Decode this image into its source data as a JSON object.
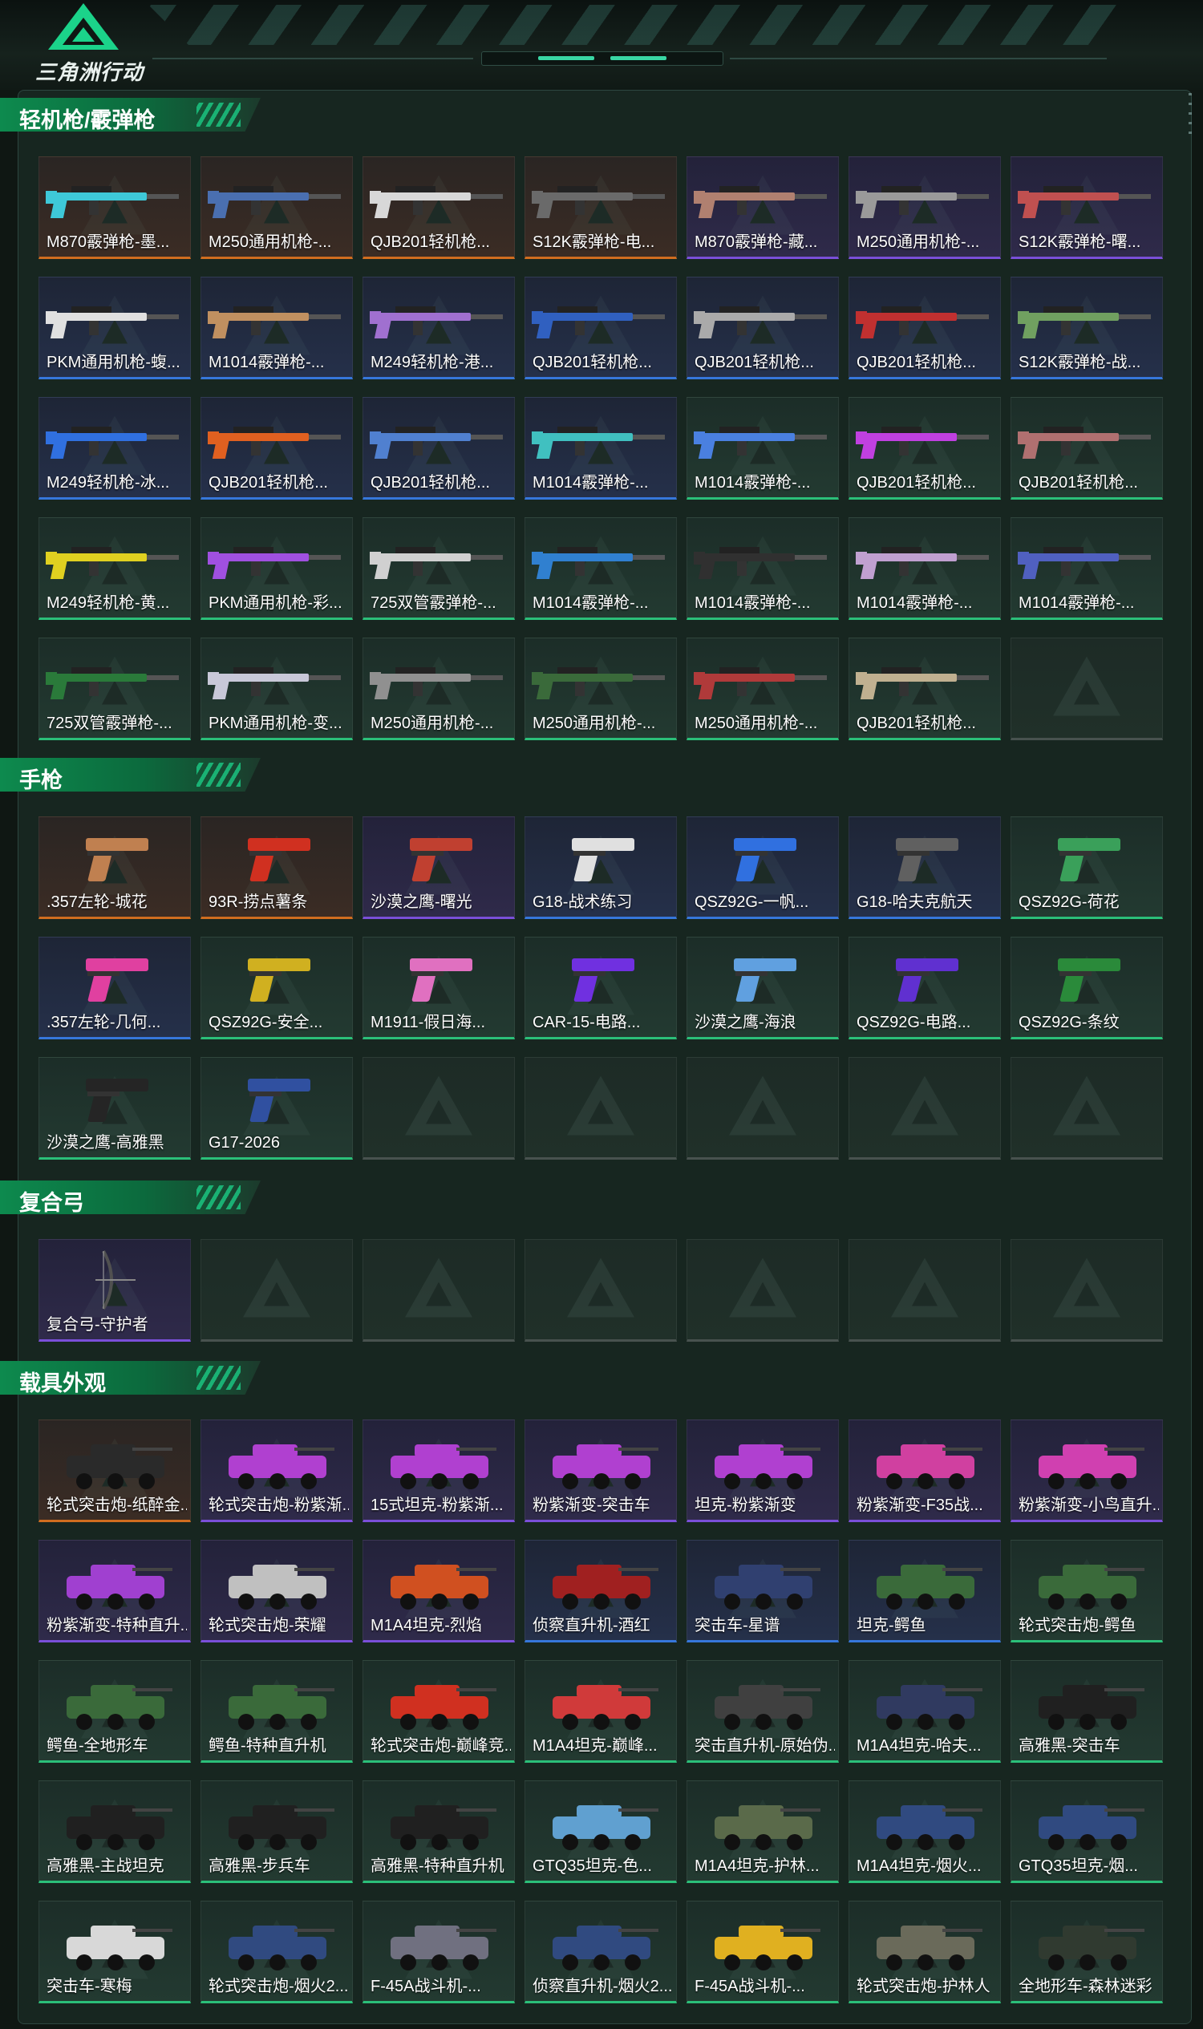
{
  "app": {
    "title": "三角洲行动"
  },
  "sections": [
    {
      "title": "轻机枪/霰弹枪",
      "kind": "gun",
      "items": [
        {
          "label": "M870霰弹枪-墨...",
          "tier": "orange",
          "art": "#3ec8d8"
        },
        {
          "label": "M250通用机枪-...",
          "tier": "orange",
          "art": "#4a6fb0"
        },
        {
          "label": "QJB201轻机枪...",
          "tier": "orange",
          "art": "#d8d8d8"
        },
        {
          "label": "S12K霰弹枪-电...",
          "tier": "orange",
          "art": "#6a6a6a"
        },
        {
          "label": "M870霰弹枪-藏...",
          "tier": "purple",
          "art": "#b08070"
        },
        {
          "label": "M250通用机枪-...",
          "tier": "purple",
          "art": "#9a9a9a"
        },
        {
          "label": "S12K霰弹枪-曙...",
          "tier": "purple",
          "art": "#c05050"
        },
        {
          "label": "PKM通用机枪-蝮...",
          "tier": "blue",
          "art": "#e0e0e0"
        },
        {
          "label": "M1014霰弹枪-...",
          "tier": "blue",
          "art": "#c09060"
        },
        {
          "label": "M249轻机枪-港...",
          "tier": "blue",
          "art": "#a070d0"
        },
        {
          "label": "QJB201轻机枪...",
          "tier": "blue",
          "art": "#3060c0"
        },
        {
          "label": "QJB201轻机枪...",
          "tier": "blue",
          "art": "#aaaaaa"
        },
        {
          "label": "QJB201轻机枪...",
          "tier": "blue",
          "art": "#c03030"
        },
        {
          "label": "S12K霰弹枪-战...",
          "tier": "blue",
          "art": "#70a060"
        },
        {
          "label": "M249轻机枪-冰...",
          "tier": "blue",
          "art": "#3070e0"
        },
        {
          "label": "QJB201轻机枪...",
          "tier": "blue",
          "art": "#e06020"
        },
        {
          "label": "QJB201轻机枪...",
          "tier": "blue",
          "art": "#5080d0"
        },
        {
          "label": "M1014霰弹枪-...",
          "tier": "blue",
          "art": "#40c0c0"
        },
        {
          "label": "M1014霰弹枪-...",
          "tier": "green",
          "art": "#4a80e0"
        },
        {
          "label": "QJB201轻机枪...",
          "tier": "green",
          "art": "#c040e0"
        },
        {
          "label": "QJB201轻机枪...",
          "tier": "green",
          "art": "#b07070"
        },
        {
          "label": "M249轻机枪-黄...",
          "tier": "green",
          "art": "#e0d020"
        },
        {
          "label": "PKM通用机枪-彩...",
          "tier": "green",
          "art": "#a050e0"
        },
        {
          "label": "725双管霰弹枪-...",
          "tier": "green",
          "art": "#d0d0d0"
        },
        {
          "label": "M1014霰弹枪-...",
          "tier": "green",
          "art": "#3080d0"
        },
        {
          "label": "M1014霰弹枪-...",
          "tier": "green",
          "art": "#303030"
        },
        {
          "label": "M1014霰弹枪-...",
          "tier": "green",
          "art": "#c0a0d0"
        },
        {
          "label": "M1014霰弹枪-...",
          "tier": "green",
          "art": "#5060c0"
        },
        {
          "label": "725双管霰弹枪-...",
          "tier": "green",
          "art": "#2a7a3a"
        },
        {
          "label": "PKM通用机枪-变...",
          "tier": "green",
          "art": "#c8c8d8"
        },
        {
          "label": "M250通用机枪-...",
          "tier": "green",
          "art": "#909090"
        },
        {
          "label": "M250通用机枪-...",
          "tier": "green",
          "art": "#3a6a3a"
        },
        {
          "label": "M250通用机枪-...",
          "tier": "green",
          "art": "#b03a3a"
        },
        {
          "label": "QJB201轻机枪...",
          "tier": "green",
          "art": "#c0b090"
        },
        {
          "label": "",
          "tier": "empty",
          "art": ""
        }
      ]
    },
    {
      "title": "手枪",
      "kind": "pistol",
      "items": [
        {
          "label": ".357左轮-城花",
          "tier": "orange",
          "art": "#c08050"
        },
        {
          "label": "93R-捞点薯条",
          "tier": "orange",
          "art": "#d03020"
        },
        {
          "label": "沙漠之鹰-曙光",
          "tier": "purple",
          "art": "#c04030"
        },
        {
          "label": "G18-战术练习",
          "tier": "blue",
          "art": "#e0e0e0"
        },
        {
          "label": "QSZ92G-一帆...",
          "tier": "blue",
          "art": "#3070e0"
        },
        {
          "label": "G18-哈夫克航天",
          "tier": "blue",
          "art": "#606060"
        },
        {
          "label": "QSZ92G-荷花",
          "tier": "green",
          "art": "#3aa05a"
        },
        {
          "label": ".357左轮-几何...",
          "tier": "blue",
          "art": "#e040a0"
        },
        {
          "label": "QSZ92G-安全...",
          "tier": "green",
          "art": "#d0b020"
        },
        {
          "label": "M1911-假日海...",
          "tier": "green",
          "art": "#e070c0"
        },
        {
          "label": "CAR-15-电路...",
          "tier": "green",
          "art": "#7030e0"
        },
        {
          "label": "沙漠之鹰-海浪",
          "tier": "green",
          "art": "#60a0e0"
        },
        {
          "label": "QSZ92G-电路...",
          "tier": "green",
          "art": "#6030d0"
        },
        {
          "label": "QSZ92G-条纹",
          "tier": "green",
          "art": "#2a8a3a"
        },
        {
          "label": "沙漠之鹰-高雅黑",
          "tier": "green",
          "art": "#252525"
        },
        {
          "label": "G17-2026",
          "tier": "green",
          "art": "#3050a0"
        },
        {
          "label": "",
          "tier": "empty",
          "art": ""
        },
        {
          "label": "",
          "tier": "empty",
          "art": ""
        },
        {
          "label": "",
          "tier": "empty",
          "art": ""
        },
        {
          "label": "",
          "tier": "empty",
          "art": ""
        },
        {
          "label": "",
          "tier": "empty",
          "art": ""
        }
      ]
    },
    {
      "title": "复合弓",
      "kind": "bow",
      "items": [
        {
          "label": "复合弓-守护者",
          "tier": "purple",
          "art": "#505050"
        },
        {
          "label": "",
          "tier": "empty",
          "art": ""
        },
        {
          "label": "",
          "tier": "empty",
          "art": ""
        },
        {
          "label": "",
          "tier": "empty",
          "art": ""
        },
        {
          "label": "",
          "tier": "empty",
          "art": ""
        },
        {
          "label": "",
          "tier": "empty",
          "art": ""
        },
        {
          "label": "",
          "tier": "empty",
          "art": ""
        }
      ]
    },
    {
      "title": "载具外观",
      "kind": "vehicle",
      "items": [
        {
          "label": "轮式突击炮-纸醉金...",
          "tier": "orange",
          "art": "#2a2a2a"
        },
        {
          "label": "轮式突击炮-粉紫渐...",
          "tier": "purple",
          "art": "#b040d0"
        },
        {
          "label": "15式坦克-粉紫渐...",
          "tier": "purple",
          "art": "#b040d0"
        },
        {
          "label": "粉紫渐变-突击车",
          "tier": "purple",
          "art": "#b040d0"
        },
        {
          "label": "坦克-粉紫渐变",
          "tier": "purple",
          "art": "#b040d0"
        },
        {
          "label": "粉紫渐变-F35战...",
          "tier": "purple",
          "art": "#d040a0"
        },
        {
          "label": "粉紫渐变-小鸟直升...",
          "tier": "purple",
          "art": "#d040b0"
        },
        {
          "label": "粉紫渐变-特种直升...",
          "tier": "purple",
          "art": "#a040d0"
        },
        {
          "label": "轮式突击炮-荣耀",
          "tier": "purple",
          "art": "#c0c0c0"
        },
        {
          "label": "M1A4坦克-烈焰",
          "tier": "purple",
          "art": "#d05020"
        },
        {
          "label": "侦察直升机-酒红",
          "tier": "blue",
          "art": "#a02020"
        },
        {
          "label": "突击车-星谱",
          "tier": "blue",
          "art": "#304070"
        },
        {
          "label": "坦克-鳄鱼",
          "tier": "blue",
          "art": "#3a6a3a"
        },
        {
          "label": "轮式突击炮-鳄鱼",
          "tier": "green",
          "art": "#3a6a3a"
        },
        {
          "label": "鳄鱼-全地形车",
          "tier": "green",
          "art": "#3a6a3a"
        },
        {
          "label": "鳄鱼-特种直升机",
          "tier": "green",
          "art": "#3a6a3a"
        },
        {
          "label": "轮式突击炮-巅峰竞...",
          "tier": "green",
          "art": "#d03020"
        },
        {
          "label": "M1A4坦克-巅峰...",
          "tier": "green",
          "art": "#d03a3a"
        },
        {
          "label": "突击直升机-原始伪...",
          "tier": "green",
          "art": "#404040"
        },
        {
          "label": "M1A4坦克-哈夫...",
          "tier": "green",
          "art": "#303a60"
        },
        {
          "label": "高雅黑-突击车",
          "tier": "green",
          "art": "#202020"
        },
        {
          "label": "高雅黑-主战坦克",
          "tier": "green",
          "art": "#202020"
        },
        {
          "label": "高雅黑-步兵车",
          "tier": "green",
          "art": "#202020"
        },
        {
          "label": "高雅黑-特种直升机",
          "tier": "green",
          "art": "#202020"
        },
        {
          "label": "GTQ35坦克-色...",
          "tier": "green",
          "art": "#60a0d0"
        },
        {
          "label": "M1A4坦克-护林...",
          "tier": "green",
          "art": "#5a6a4a"
        },
        {
          "label": "M1A4坦克-烟火...",
          "tier": "green",
          "art": "#304a80"
        },
        {
          "label": "GTQ35坦克-烟...",
          "tier": "green",
          "art": "#304a80"
        },
        {
          "label": "突击车-寒梅",
          "tier": "green",
          "art": "#d8d8d8"
        },
        {
          "label": "轮式突击炮-烟火2...",
          "tier": "green",
          "art": "#304a80"
        },
        {
          "label": "F-45A战斗机-...",
          "tier": "green",
          "art": "#707080"
        },
        {
          "label": "侦察直升机-烟火2...",
          "tier": "green",
          "art": "#304a80"
        },
        {
          "label": "F-45A战斗机-...",
          "tier": "green",
          "art": "#e0b020"
        },
        {
          "label": "轮式突击炮-护林人",
          "tier": "green",
          "art": "#6a6a5a"
        },
        {
          "label": "全地形车-森林迷彩",
          "tier": "green",
          "art": "#303a30"
        }
      ]
    }
  ]
}
